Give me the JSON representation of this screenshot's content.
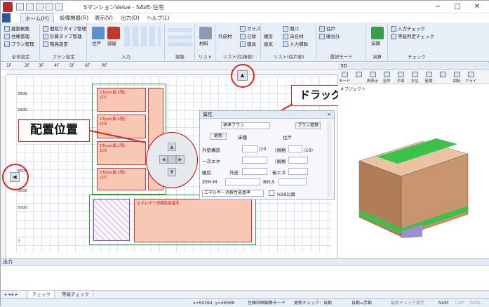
{
  "window": {
    "title": "SマンションValue - SAVE-住宅",
    "minimize": "−",
    "maximize": "□",
    "close": "✕"
  },
  "tabs": [
    "ホーム(H)",
    "設備機器(R)",
    "表示(V)",
    "出力(O)",
    "ヘルプ(L)"
  ],
  "ribbon": {
    "groups": [
      {
        "label": "全体設定",
        "items": [
          "建築概要",
          "住棟管理",
          "プラン管理"
        ]
      },
      {
        "label": "プラン設定",
        "items": [
          "間取りタイプ管理",
          "計算タイプ管理",
          "階高設定"
        ]
      },
      {
        "label": "入力",
        "items": [
          "住戸",
          "部屋"
        ]
      },
      {
        "label": "編集",
        "items": []
      },
      {
        "label": "リスト",
        "items": [
          "材料"
        ]
      },
      {
        "label": "リスト(住棟部)",
        "items": [
          "外皮材",
          "ガラス",
          "日除",
          "建具"
        ]
      },
      {
        "label": "リスト(住戸部)",
        "items": [
          "暖房",
          "開口",
          "床合材",
          "換気",
          "入力補助"
        ]
      },
      {
        "label": "選択モード",
        "items": [
          "住戸",
          "暖合計"
        ]
      },
      {
        "label": "演算",
        "items": [
          "演算"
        ]
      },
      {
        "label": "チェック",
        "items": [
          "入力チェック",
          "等級判定チェック"
        ]
      }
    ]
  },
  "floor_tabs": [
    "1F",
    "2F",
    "3F",
    "4F",
    "5F",
    "6F",
    "RF"
  ],
  "ruler": {
    "left_values": [
      "5500",
      "5500",
      "6500",
      "5000",
      "5000",
      "7"
    ]
  },
  "rooms": [
    {
      "text": "1Type(最上階)\n101"
    },
    {
      "text": "1Type(最上階)\n103"
    },
    {
      "text": "1Type(最上階)\n105"
    },
    {
      "text": "1Type(最上階)\n107"
    },
    {
      "text": "エネルギー消費性能基準"
    }
  ],
  "callouts": {
    "placement": "配置位置",
    "drag": "ドラッグ"
  },
  "properties": {
    "title": "属性",
    "plan_label": "標準プラン",
    "plan_value": "標準プラン",
    "plan_button": "プラン管理",
    "update": "更新",
    "floor_label": "床種",
    "dwelling_label": "住戸",
    "wall_label": "外壁構造",
    "wall_unit": "/10",
    "insulation_label": "（規格",
    "insulation_unit": "/10）",
    "energy_label": "一次エネ",
    "energy_paren": "（規格",
    "heating_label": "暖房",
    "outer_label": "外皮",
    "save_label": "省エネ",
    "zeh_label": "ZEH-M",
    "bels_label": "BELS",
    "standard_value": "エネルギー消費性能基準",
    "high_perf": "H28以降"
  },
  "pane3d": {
    "title": "3D",
    "tools": [
      "モード",
      "",
      "再表示",
      "全体",
      "平面",
      "方位",
      "座標",
      "",
      "回転",
      "フライ"
    ],
    "object_label": "オブジェクト"
  },
  "output": {
    "title": "出力"
  },
  "output_tabs": [
    "チェック",
    "等級チェック"
  ],
  "status": {
    "coords": "x=64264, y=46588",
    "mode": "住棟詳細編集モード",
    "update": "更新チェック：自動",
    "auto": "自動↔手動",
    "reverse": "最新チェック実行",
    "num": "NUM",
    "cap": "CAP",
    "scrl": "SCRL"
  },
  "colors": {
    "accent": "#2b579a",
    "room_fill": "#f7c9b4",
    "room_border": "#d23a3a",
    "callout": "#d22222"
  }
}
